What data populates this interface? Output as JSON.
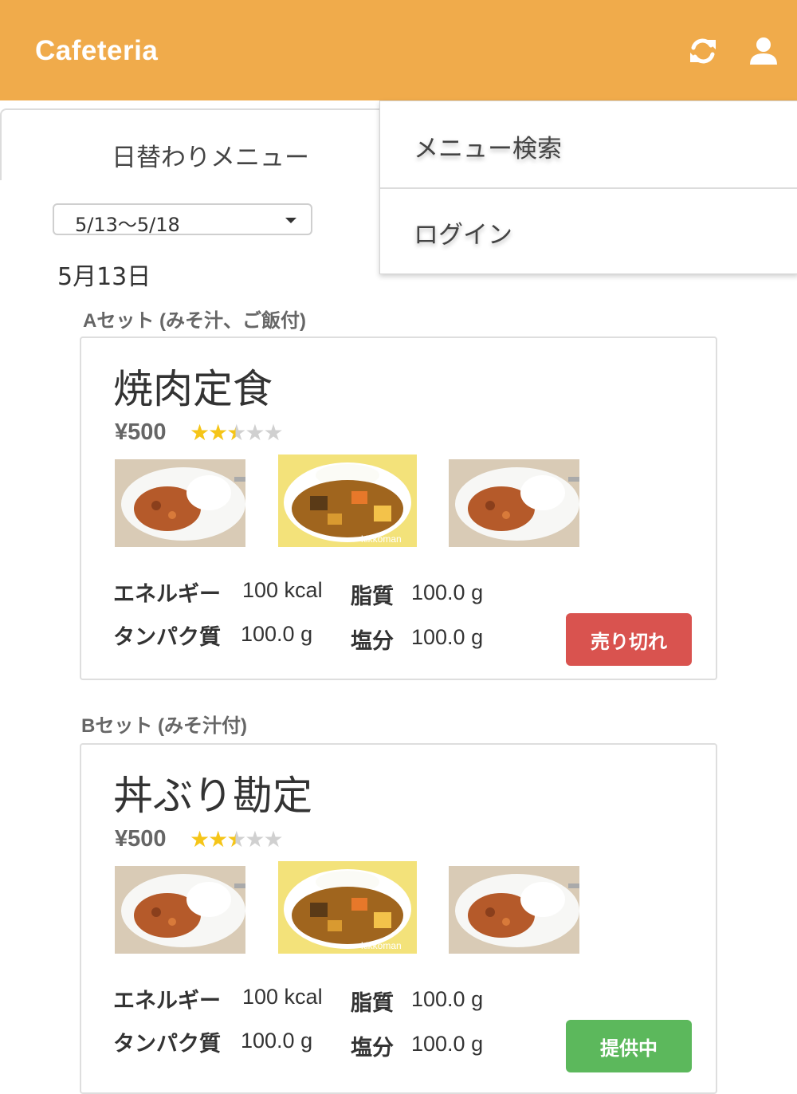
{
  "header": {
    "brand": "Cafeteria",
    "icons": [
      "refresh-icon",
      "user-icon"
    ]
  },
  "tabs": {
    "active_label": "日替わりメニュー"
  },
  "week_select": {
    "value": "5/13〜5/18"
  },
  "date": "5月13日",
  "menu_dropdown": {
    "items": [
      "メニュー検索",
      "ログイン"
    ]
  },
  "sets": [
    {
      "label": "Aセット (みそ汁、ご飯付)",
      "name": "焼肉定食",
      "price": "¥500",
      "rating": 2.5,
      "rating_max": 5,
      "photo_watermark": "kikkoman",
      "nutrition": {
        "energy_label": "エネルギー",
        "energy_value": "100 kcal",
        "protein_label": "タンパク質",
        "protein_value": "100.0 g",
        "fat_label": "脂質",
        "fat_value": "100.0 g",
        "salt_label": "塩分",
        "salt_value": "100.0 g"
      },
      "status": "売り切れ",
      "status_color": "#d9534f"
    },
    {
      "label": "Bセット (みそ汁付)",
      "name": "丼ぶり勘定",
      "price": "¥500",
      "rating": 2.5,
      "rating_max": 5,
      "photo_watermark": "kikkoman",
      "nutrition": {
        "energy_label": "エネルギー",
        "energy_value": "100 kcal",
        "protein_label": "タンパク質",
        "protein_value": "100.0 g",
        "fat_label": "脂質",
        "fat_value": "100.0 g",
        "salt_label": "塩分",
        "salt_value": "100.0 g"
      },
      "status": "提供中",
      "status_color": "#5cb85c"
    }
  ],
  "colors": {
    "header": "#f0ab4b",
    "star": "#f5c518"
  }
}
